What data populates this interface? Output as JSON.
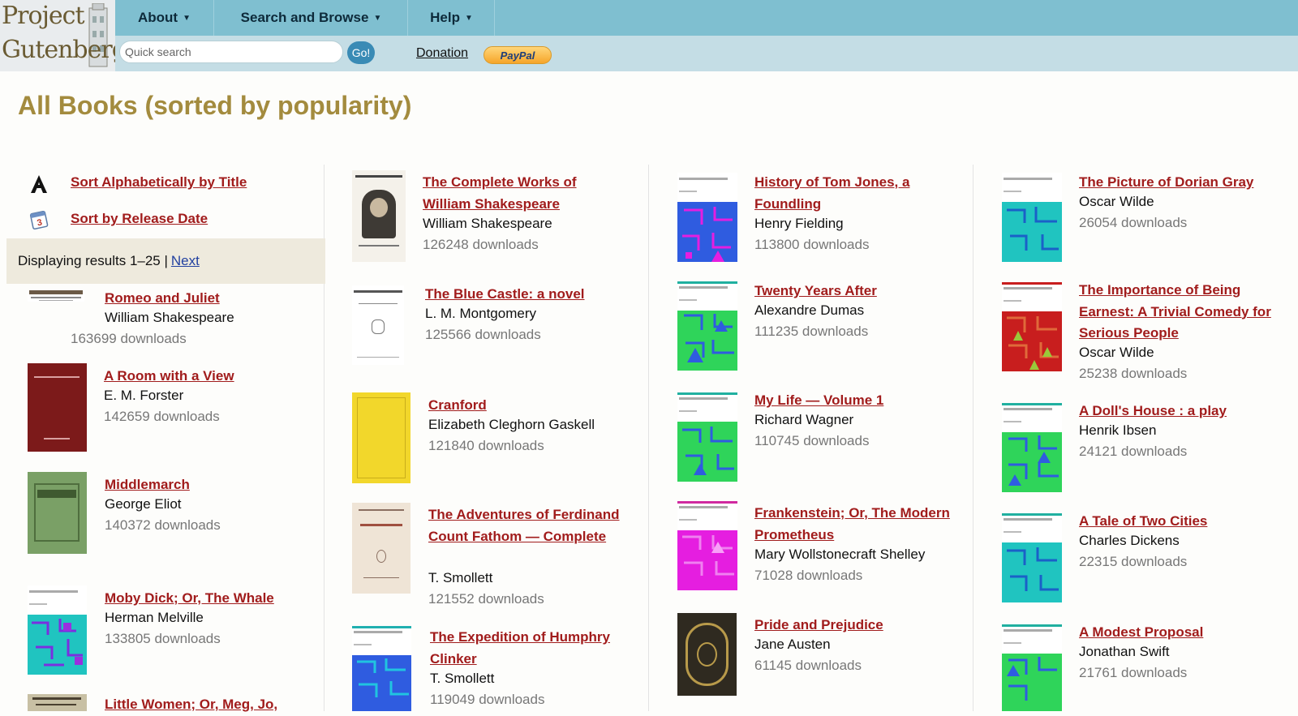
{
  "header": {
    "logo_line1": "Project",
    "logo_line2": "Gutenberg",
    "menu": [
      {
        "label": "About"
      },
      {
        "label": "Search and Browse"
      },
      {
        "label": "Help"
      }
    ],
    "search_placeholder": "Quick search",
    "go_label": "Go!",
    "donation_label": "Donation",
    "paypal_label": "PayPal"
  },
  "page_title": "All Books (sorted by popularity)",
  "sort": {
    "alpha_label": "Sort Alphabetically by Title",
    "date_label": "Sort by Release Date"
  },
  "results": {
    "text": "Displaying results 1–25 |",
    "next_label": "Next"
  },
  "books": [
    {
      "title": "Romeo and Juliet",
      "author": "William Shakespeare",
      "downloads": "163699 downloads"
    },
    {
      "title": "A Room with a View",
      "author": "E. M. Forster",
      "downloads": "142659 downloads"
    },
    {
      "title": "Middlemarch",
      "author": "George Eliot",
      "downloads": "140372 downloads"
    },
    {
      "title": "Moby Dick; Or, The Whale",
      "author": "Herman Melville",
      "downloads": "133805 downloads"
    },
    {
      "title": "Little Women; Or, Meg, Jo,",
      "author": "",
      "downloads": ""
    },
    {
      "title": "The Complete Works of William Shakespeare",
      "author": "William Shakespeare",
      "downloads": "126248 downloads"
    },
    {
      "title": "The Blue Castle: a novel",
      "author": "L. M. Montgomery",
      "downloads": "125566 downloads"
    },
    {
      "title": "Cranford",
      "author": "Elizabeth Cleghorn Gaskell",
      "downloads": "121840 downloads"
    },
    {
      "title": "The Adventures of Ferdinand Count Fathom — Complete",
      "author": "T. Smollett",
      "downloads": "121552 downloads"
    },
    {
      "title": "The Expedition of Humphry Clinker",
      "author": "T. Smollett",
      "downloads": "119049 downloads"
    },
    {
      "title": "History of Tom Jones, a Foundling",
      "author": "Henry Fielding",
      "downloads": "113800 downloads"
    },
    {
      "title": "Twenty Years After",
      "author": "Alexandre Dumas",
      "downloads": "111235 downloads"
    },
    {
      "title": "My Life — Volume 1",
      "author": "Richard Wagner",
      "downloads": "110745 downloads"
    },
    {
      "title": "Frankenstein; Or, The Modern Prometheus",
      "author": "Mary Wollstonecraft Shelley",
      "downloads": "71028 downloads"
    },
    {
      "title": "Pride and Prejudice",
      "author": "Jane Austen",
      "downloads": "61145 downloads"
    },
    {
      "title": "The Picture of Dorian Gray",
      "author": "Oscar Wilde",
      "downloads": "26054 downloads"
    },
    {
      "title": "The Importance of Being Earnest: A Trivial Comedy for Serious People",
      "author": "Oscar Wilde",
      "downloads": "25238 downloads"
    },
    {
      "title": "A Doll's House : a play",
      "author": "Henrik Ibsen",
      "downloads": "24121 downloads"
    },
    {
      "title": "A Tale of Two Cities",
      "author": "Charles Dickens",
      "downloads": "22315 downloads"
    },
    {
      "title": "A Modest Proposal",
      "author": "Jonathan Swift",
      "downloads": "21761 downloads"
    }
  ],
  "cover_colors": {
    "blue": "#2f5ce0",
    "cyan": "#20c4c0",
    "green": "#2fd45a",
    "magenta": "#e51ee0",
    "red": "#c81e1e",
    "accent_pink": "#d02aa0",
    "accent_teal": "#1aa090",
    "accent_violet": "#9a2fe0"
  }
}
